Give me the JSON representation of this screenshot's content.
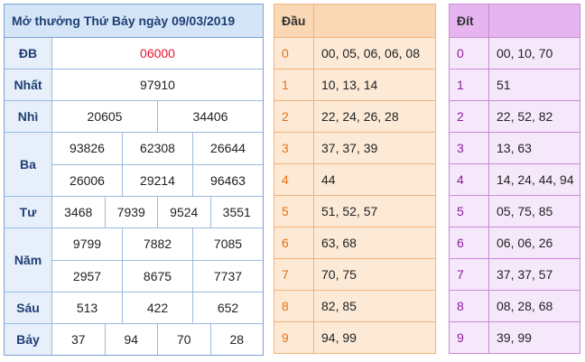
{
  "title": "Mở thưởng Thứ Bảy ngày 09/03/2019",
  "prizes": [
    {
      "label": "ĐB",
      "lines": [
        [
          "06000"
        ]
      ]
    },
    {
      "label": "Nhất",
      "lines": [
        [
          "97910"
        ]
      ]
    },
    {
      "label": "Nhì",
      "lines": [
        [
          "20605",
          "34406"
        ]
      ]
    },
    {
      "label": "Ba",
      "lines": [
        [
          "93826",
          "62308",
          "26644"
        ],
        [
          "26006",
          "29214",
          "96463"
        ]
      ]
    },
    {
      "label": "Tư",
      "lines": [
        [
          "3468",
          "7939",
          "9524",
          "3551"
        ]
      ]
    },
    {
      "label": "Năm",
      "lines": [
        [
          "9799",
          "7882",
          "7085"
        ],
        [
          "2957",
          "8675",
          "7737"
        ]
      ]
    },
    {
      "label": "Sáu",
      "lines": [
        [
          "513",
          "422",
          "652"
        ]
      ]
    },
    {
      "label": "Bảy",
      "lines": [
        [
          "37",
          "94",
          "70",
          "28"
        ]
      ]
    }
  ],
  "dau_table": {
    "header": "Đầu",
    "rows": [
      {
        "key": "0",
        "value": "00, 05, 06, 06, 08"
      },
      {
        "key": "1",
        "value": "10, 13, 14"
      },
      {
        "key": "2",
        "value": "22, 24, 26, 28"
      },
      {
        "key": "3",
        "value": "37, 37, 39"
      },
      {
        "key": "4",
        "value": "44"
      },
      {
        "key": "5",
        "value": "51, 52, 57"
      },
      {
        "key": "6",
        "value": "63, 68"
      },
      {
        "key": "7",
        "value": "70, 75"
      },
      {
        "key": "8",
        "value": "82, 85"
      },
      {
        "key": "9",
        "value": "94, 99"
      }
    ]
  },
  "dit_table": {
    "header": "Đít",
    "rows": [
      {
        "key": "0",
        "value": "00, 10, 70"
      },
      {
        "key": "1",
        "value": "51"
      },
      {
        "key": "2",
        "value": "22, 52, 82"
      },
      {
        "key": "3",
        "value": "13, 63"
      },
      {
        "key": "4",
        "value": "14, 24, 44, 94"
      },
      {
        "key": "5",
        "value": "05, 75, 85"
      },
      {
        "key": "6",
        "value": "06, 06, 26"
      },
      {
        "key": "7",
        "value": "37, 37, 57"
      },
      {
        "key": "8",
        "value": "08, 28, 68"
      },
      {
        "key": "9",
        "value": "39, 99"
      }
    ]
  },
  "colors": {
    "special_prize": "#e8132d",
    "main_header_bg": "#d4e5f7",
    "dau_bg": "#fcead6",
    "dau_key": "#e87011",
    "dit_bg": "#f6e8fb",
    "dit_key": "#8b1d9c"
  }
}
